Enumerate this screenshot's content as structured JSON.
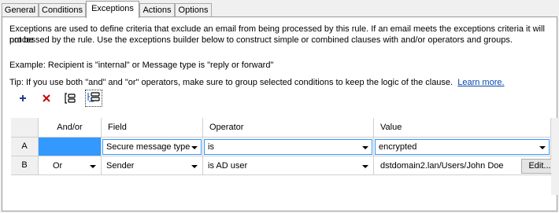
{
  "tabs": [
    "General",
    "Conditions",
    "Exceptions",
    "Actions",
    "Options"
  ],
  "active_tab": "Exceptions",
  "description_line1": "Exceptions are used to define criteria that exclude an email from being processed by this rule. If an email meets the exceptions criteria it will not be",
  "description_line2": "processed by the rule. Use the exceptions builder below to construct simple or combined clauses with and/or operators and groups.",
  "example": "Example: Recipient is \"internal\" or Message type is \"reply or forward\"",
  "tip": "Tip: If you use both \"and\" and \"or\" operators, make sure to group selected conditions to keep the logic of the clause.",
  "learn_more": "Learn more.",
  "toolbar": {
    "add": "plus-icon",
    "remove": "x-icon",
    "group": "group-icon",
    "ungroup": "ungroup-icon"
  },
  "grid": {
    "columns": [
      "And/or",
      "Field",
      "Operator",
      "Value"
    ],
    "rows": [
      {
        "id": "A",
        "andor": "",
        "field": "Secure message type",
        "operator": "is",
        "value": "encrypted"
      },
      {
        "id": "B",
        "andor": "Or",
        "field": "Sender",
        "operator": "is AD user",
        "value": "dstdomain2.lan/Users/John Doe",
        "button": "Edit..."
      }
    ]
  },
  "colors": {
    "selection": "#3399ff",
    "link": "#0645ad",
    "remove": "#cc0000",
    "add": "#1f3f8a"
  }
}
